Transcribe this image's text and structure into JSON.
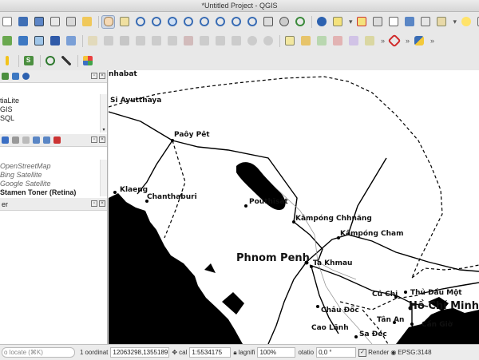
{
  "window": {
    "title": "*Untitled Project - QGIS"
  },
  "browser_panel": {
    "items": [
      "tiaLite",
      "GIS",
      "SQL"
    ]
  },
  "layers_panel": {
    "items": [
      {
        "label": "OpenStreetMap",
        "style": "italic"
      },
      {
        "label": "Bing Satellite",
        "style": "italic"
      },
      {
        "label": "Google Satellite",
        "style": "italic"
      },
      {
        "label": "Stamen Toner (Retina)",
        "style": "bold"
      }
    ]
  },
  "third_panel": {
    "title": "er"
  },
  "statusbar": {
    "locate_placeholder": "o locate (⌘K)",
    "badge": "1",
    "coord_label": "oordinat",
    "coord_value": "12063298,1355189",
    "scale_label": "cal",
    "scale_value": "1:5534175",
    "magnifier_label": "lagnifi",
    "magnifier_value": "100%",
    "rotation_label": "otatio",
    "rotation_value": "0,0 °",
    "render_label": "Render",
    "crs": "EPSG:3148"
  },
  "map": {
    "labels": [
      {
        "id": "nhabat",
        "text": "nhabat"
      },
      {
        "id": "si-ayutthaya",
        "text": "Si Ayutthaya"
      },
      {
        "id": "paoy-pet",
        "text": "Paôy Pêt"
      },
      {
        "id": "klaeng",
        "text": "Klaeng"
      },
      {
        "id": "chanthaburi",
        "text": "Chanthaburi"
      },
      {
        "id": "pouthisat",
        "text": "Poŭthĭsăt"
      },
      {
        "id": "kampong-chhnang",
        "text": "Kâmpóng Chhnăng"
      },
      {
        "id": "kampong-cham",
        "text": "Kâmpóng Cham"
      },
      {
        "id": "phnom-penh",
        "text": "Phnom Penh"
      },
      {
        "id": "ta-khmau",
        "text": "Ta Khmau"
      },
      {
        "id": "cu-chi",
        "text": "Củ Chi"
      },
      {
        "id": "thu-dau-mot",
        "text": "Thủ Dầu Một"
      },
      {
        "id": "ho-chi-minh",
        "text": "Hồ Chí Minh"
      },
      {
        "id": "chau-doc",
        "text": "Châu Đốc"
      },
      {
        "id": "tan-an",
        "text": "Tân An"
      },
      {
        "id": "can-gio",
        "text": "Cần Giờ"
      },
      {
        "id": "cao-lanh",
        "text": "Cao Lãnh"
      },
      {
        "id": "sa-dec",
        "text": "Sa Đéc"
      }
    ]
  }
}
